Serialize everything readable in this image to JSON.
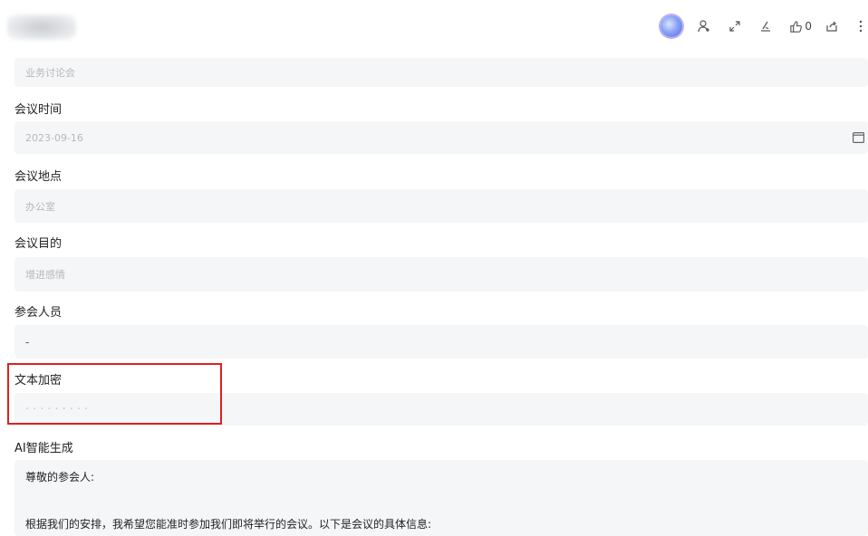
{
  "toolbar": {
    "like_count": "0",
    "icons": [
      "avatar",
      "user-add-icon",
      "expand-icon",
      "signature-icon",
      "thumbs-up-icon",
      "share-icon",
      "more-icon"
    ]
  },
  "fields": {
    "meeting_name": {
      "value": "业务讨论会"
    },
    "meeting_time": {
      "label": "会议时间",
      "value": "2023-09-16"
    },
    "meeting_place": {
      "label": "会议地点",
      "value": "办公室"
    },
    "meeting_purpose": {
      "label": "会议目的",
      "value": "增进感情"
    },
    "attendees": {
      "label": "参会人员",
      "value": "-"
    },
    "text_encrypt": {
      "label": "文本加密",
      "value": "·········"
    },
    "ai_generate": {
      "label": "AI智能生成",
      "line1": "尊敬的参会人:",
      "line2": "根据我们的安排，我希望您能准时参加我们即将举行的会议。以下是会议的具体信息:"
    }
  }
}
